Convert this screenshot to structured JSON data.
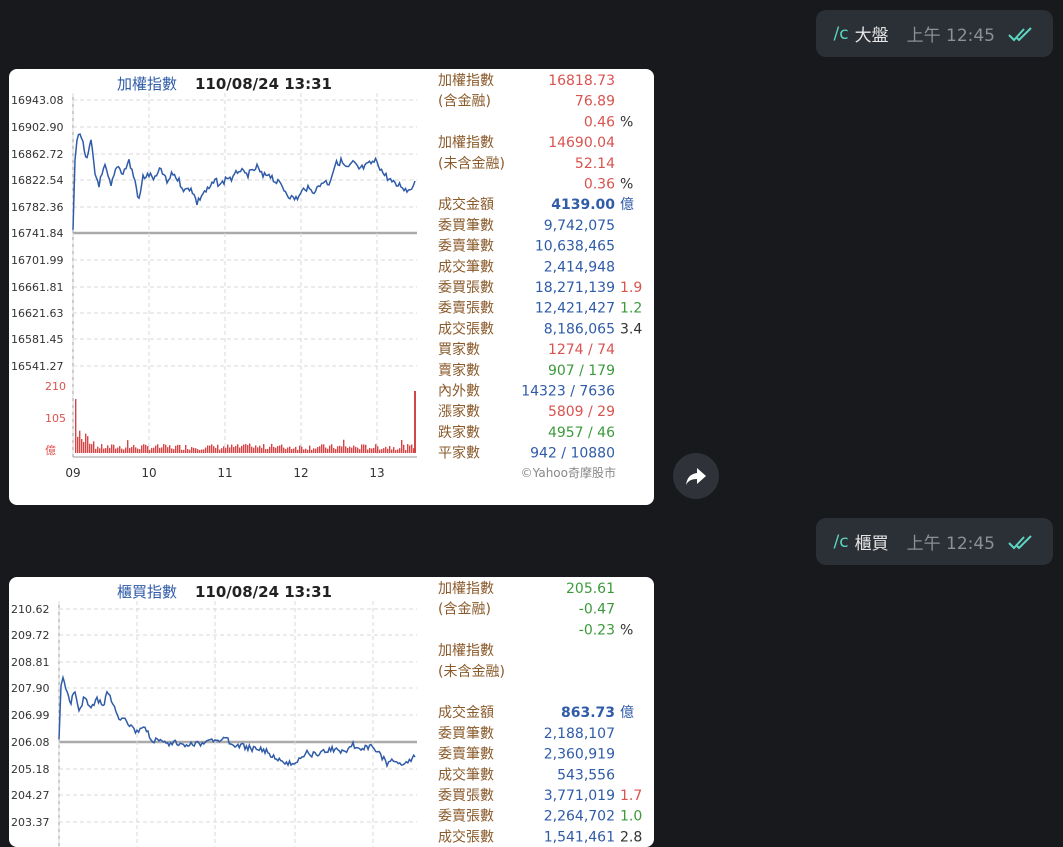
{
  "messages": [
    {
      "cmd": "/c",
      "text": "大盤",
      "time": "上午 12:45"
    },
    {
      "cmd": "/c",
      "text": "櫃買",
      "time": "上午 12:45"
    }
  ],
  "forward_icon": "share-arrow-icon",
  "read_icon": "double-check-icon",
  "colors": {
    "up": "#d9534f",
    "down": "#3c9a3c",
    "blue": "#2f5ba8",
    "label": "#8a5a2b"
  },
  "card1": {
    "title_name": "加權指數",
    "title_date": "110/08/24 13:31",
    "y_labels": [
      "16943.08",
      "16902.90",
      "16862.72",
      "16822.54",
      "16782.36",
      "16741.84",
      "16701.99",
      "16661.81",
      "16621.63",
      "16581.45",
      "16541.27"
    ],
    "vol_labels": [
      "210",
      "105",
      "億"
    ],
    "x_labels": [
      "09",
      "10",
      "11",
      "12",
      "13"
    ],
    "credit": "©Yahoo奇摩股市",
    "stats": [
      {
        "label": "加權指數",
        "value": "16818.73",
        "vcolor": "up",
        "ext": "",
        "ecolor": ""
      },
      {
        "label": "(含金融)",
        "value": "76.89",
        "vcolor": "up",
        "ext": "",
        "ecolor": ""
      },
      {
        "label": "",
        "value": "0.46",
        "vcolor": "up",
        "ext": "%",
        "ecolor": "dark"
      },
      {
        "label": "加權指數",
        "value": "14690.04",
        "vcolor": "up",
        "ext": "",
        "ecolor": ""
      },
      {
        "label": "(未含金融)",
        "value": "52.14",
        "vcolor": "up",
        "ext": "",
        "ecolor": ""
      },
      {
        "label": "",
        "value": "0.36",
        "vcolor": "up",
        "ext": "%",
        "ecolor": "dark"
      },
      {
        "label": "成交金額",
        "value": "4139.00",
        "vcolor": "bold",
        "ext": "億",
        "ecolor": "blue"
      },
      {
        "label": "委買筆數",
        "value": "9,742,075",
        "vcolor": "blue",
        "ext": "",
        "ecolor": ""
      },
      {
        "label": "委賣筆數",
        "value": "10,638,465",
        "vcolor": "blue",
        "ext": "",
        "ecolor": ""
      },
      {
        "label": "成交筆數",
        "value": "2,414,948",
        "vcolor": "blue",
        "ext": "",
        "ecolor": ""
      },
      {
        "label": "委買張數",
        "value": "18,271,139",
        "vcolor": "blue",
        "ext": "1.9",
        "ecolor": "up"
      },
      {
        "label": "委賣張數",
        "value": "12,421,427",
        "vcolor": "blue",
        "ext": "1.2",
        "ecolor": "down"
      },
      {
        "label": "成交張數",
        "value": "8,186,065",
        "vcolor": "blue",
        "ext": "3.4",
        "ecolor": "dark"
      },
      {
        "label": "買家數",
        "value": "1274 / 74",
        "vcolor": "up",
        "ext": "",
        "ecolor": ""
      },
      {
        "label": "賣家數",
        "value": "907 / 179",
        "vcolor": "down",
        "ext": "",
        "ecolor": ""
      },
      {
        "label": "內外數",
        "value": "14323 / 7636",
        "vcolor": "blue",
        "ext": "",
        "ecolor": ""
      },
      {
        "label": "漲家數",
        "value": "5809 / 29",
        "vcolor": "up",
        "ext": "",
        "ecolor": ""
      },
      {
        "label": "跌家數",
        "value": "4957 / 46",
        "vcolor": "down",
        "ext": "",
        "ecolor": ""
      },
      {
        "label": "平家數",
        "value": "942 / 10880",
        "vcolor": "blue",
        "ext": "",
        "ecolor": ""
      }
    ]
  },
  "card2": {
    "title_name": "櫃買指數",
    "title_date": "110/08/24 13:31",
    "y_labels": [
      "210.62",
      "209.72",
      "208.81",
      "207.90",
      "206.99",
      "206.08",
      "205.18",
      "204.27",
      "203.37"
    ],
    "stats": [
      {
        "label": "加權指數",
        "value": "205.61",
        "vcolor": "down",
        "ext": "",
        "ecolor": ""
      },
      {
        "label": "(含金融)",
        "value": "-0.47",
        "vcolor": "down",
        "ext": "",
        "ecolor": ""
      },
      {
        "label": "",
        "value": "-0.23",
        "vcolor": "down",
        "ext": "%",
        "ecolor": "dark"
      },
      {
        "label": "加權指數",
        "value": "",
        "vcolor": "",
        "ext": "",
        "ecolor": ""
      },
      {
        "label": "(未含金融)",
        "value": "",
        "vcolor": "",
        "ext": "",
        "ecolor": ""
      },
      {
        "label": "",
        "value": "",
        "vcolor": "",
        "ext": "",
        "ecolor": ""
      },
      {
        "label": "成交金額",
        "value": "863.73",
        "vcolor": "bold",
        "ext": "億",
        "ecolor": "blue"
      },
      {
        "label": "委買筆數",
        "value": "2,188,107",
        "vcolor": "blue",
        "ext": "",
        "ecolor": ""
      },
      {
        "label": "委賣筆數",
        "value": "2,360,919",
        "vcolor": "blue",
        "ext": "",
        "ecolor": ""
      },
      {
        "label": "成交筆數",
        "value": "543,556",
        "vcolor": "blue",
        "ext": "",
        "ecolor": ""
      },
      {
        "label": "委買張數",
        "value": "3,771,019",
        "vcolor": "blue",
        "ext": "1.7",
        "ecolor": "up"
      },
      {
        "label": "委賣張數",
        "value": "2,264,702",
        "vcolor": "blue",
        "ext": "1.0",
        "ecolor": "down"
      },
      {
        "label": "成交張數",
        "value": "1,541,461",
        "vcolor": "blue",
        "ext": "2.8",
        "ecolor": "dark"
      }
    ]
  }
}
